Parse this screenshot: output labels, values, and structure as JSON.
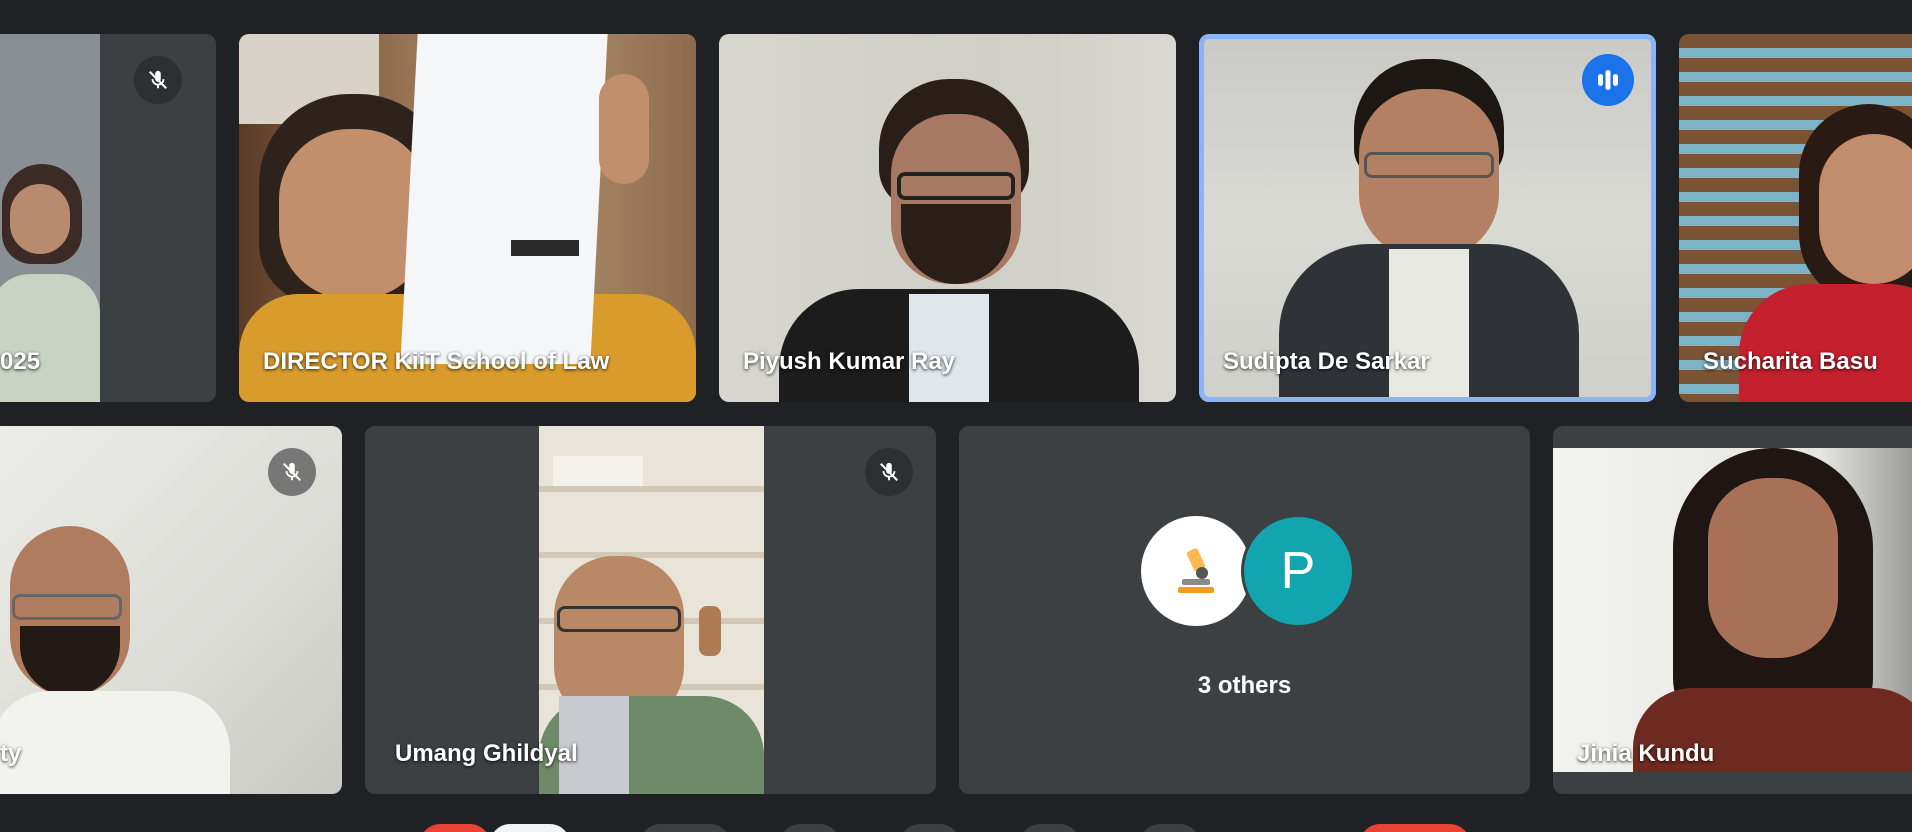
{
  "participants": {
    "t1": {
      "name": "025",
      "muted": true
    },
    "t2": {
      "name": "DIRECTOR KiiT School of Law"
    },
    "t3": {
      "name": "Piyush Kumar Ray"
    },
    "t4": {
      "name": "Sudipta De Sarkar",
      "speaking": true
    },
    "t5": {
      "name": "Sucharita Basu"
    },
    "t6": {
      "name": "ty",
      "muted": true
    },
    "t7": {
      "name": "Umang Ghildyal",
      "muted": true
    },
    "t8": {
      "others_label": "3 others",
      "avatar_letter": "P",
      "avatar_color": "#12a4af"
    },
    "t9": {
      "name": "Jinia Kundu"
    }
  },
  "colors": {
    "background": "#202124",
    "tile": "#3c4043",
    "speaking_border": "#8ab4f8",
    "speaking_badge": "#1a73e8"
  },
  "icons": {
    "mute": "mic-off-icon",
    "speaking": "audio-level-icon",
    "avatar": "microscope-icon"
  }
}
